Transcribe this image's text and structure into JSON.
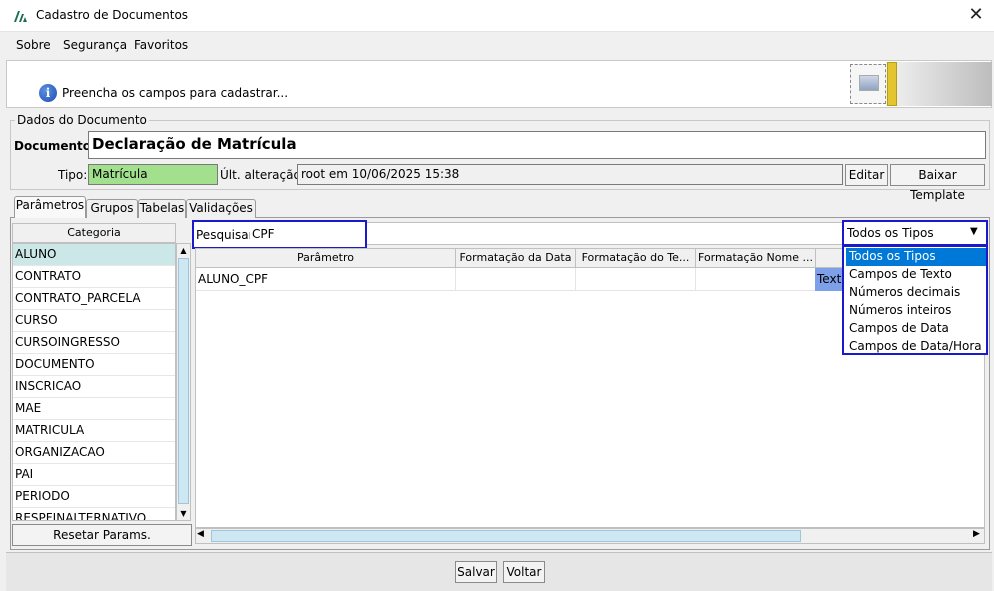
{
  "window": {
    "title": "Cadastro de Documentos",
    "close_glyph": "✕"
  },
  "menu": [
    {
      "label": "Sobre"
    },
    {
      "label": "Segurança"
    },
    {
      "label": "Favoritos"
    }
  ],
  "banner": {
    "message": "Preencha os campos para cadastrar...",
    "info_glyph": "i"
  },
  "dados": {
    "group_title": "Dados do Documento",
    "documento_label": "Documento:",
    "documento_value": "Declaração de Matrícula",
    "tipo_label": "Tipo:",
    "tipo_value": "Matrícula",
    "ult_label": "Últ. alteração:",
    "ult_value": "root em 10/06/2025 15:38",
    "editar_label": "Editar",
    "baixar_label": "Baixar Template"
  },
  "tabs": [
    {
      "label": "Parâmetros"
    },
    {
      "label": "Grupos"
    },
    {
      "label": "Tabelas"
    },
    {
      "label": "Validações"
    }
  ],
  "categoria": {
    "header": "Categoria",
    "items": [
      "ALUNO",
      "CONTRATO",
      "CONTRATO_PARCELA",
      "CURSO",
      "CURSOINGRESSO",
      "DOCUMENTO",
      "INSCRICAO",
      "MAE",
      "MATRICULA",
      "ORGANIZACAO",
      "PAI",
      "PERIODO",
      "RESPFINALTERNATIVO"
    ],
    "selected": "ALUNO",
    "reset_label": "Resetar Params."
  },
  "search": {
    "label": "Pesquisar:",
    "value": "CPF"
  },
  "type_filter": {
    "selected": "Todos os Tipos",
    "options": [
      "Todos os Tipos",
      "Campos de Texto",
      "Números decimais",
      "Números inteiros",
      "Campos de Data",
      "Campos de Data/Hora"
    ],
    "highlighted": "Todos os Tipos"
  },
  "grid": {
    "columns": [
      "Parâmetro",
      "Formatação da Data",
      "Formatação do Te...",
      "Formatação Nome ..."
    ],
    "rows": [
      {
        "parametro": "ALUNO_CPF",
        "tipo": "Texto"
      }
    ]
  },
  "footer": {
    "salvar_label": "Salvar",
    "voltar_label": "Voltar"
  },
  "colors": {
    "selected_tipo": "#a3e08e",
    "highlight_blue": "#1a1acc",
    "row_select": "#cbe7e7"
  }
}
